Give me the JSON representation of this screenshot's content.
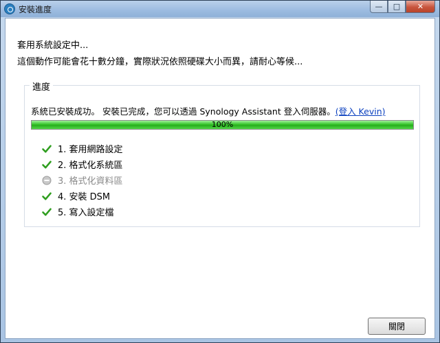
{
  "window": {
    "title": "安裝進度",
    "minimize_glyph": "—",
    "maximize_glyph": "□",
    "close_glyph": "✕"
  },
  "message": {
    "line1": "套用系統設定中...",
    "line2": "這個動作可能會花十數分鐘，實際狀況依照硬碟大小而異，請耐心等候..."
  },
  "progress_group": {
    "legend": "進度",
    "status_text": "系統已安裝成功。 安裝已完成，您可以透過 Synology Assistant 登入伺服器。",
    "login_link": "(登入 Kevin)",
    "progress_label": "100%",
    "progress_value": 1.0,
    "progress_color": "#2fbd24",
    "steps": [
      {
        "label": "1. 套用網路設定",
        "status": "done"
      },
      {
        "label": "2. 格式化系統區",
        "status": "done"
      },
      {
        "label": "3. 格式化資料區",
        "status": "skipped"
      },
      {
        "label": "4. 安裝 DSM",
        "status": "done"
      },
      {
        "label": "5. 寫入設定檔",
        "status": "done"
      }
    ]
  },
  "footer": {
    "close_label": "關閉"
  }
}
